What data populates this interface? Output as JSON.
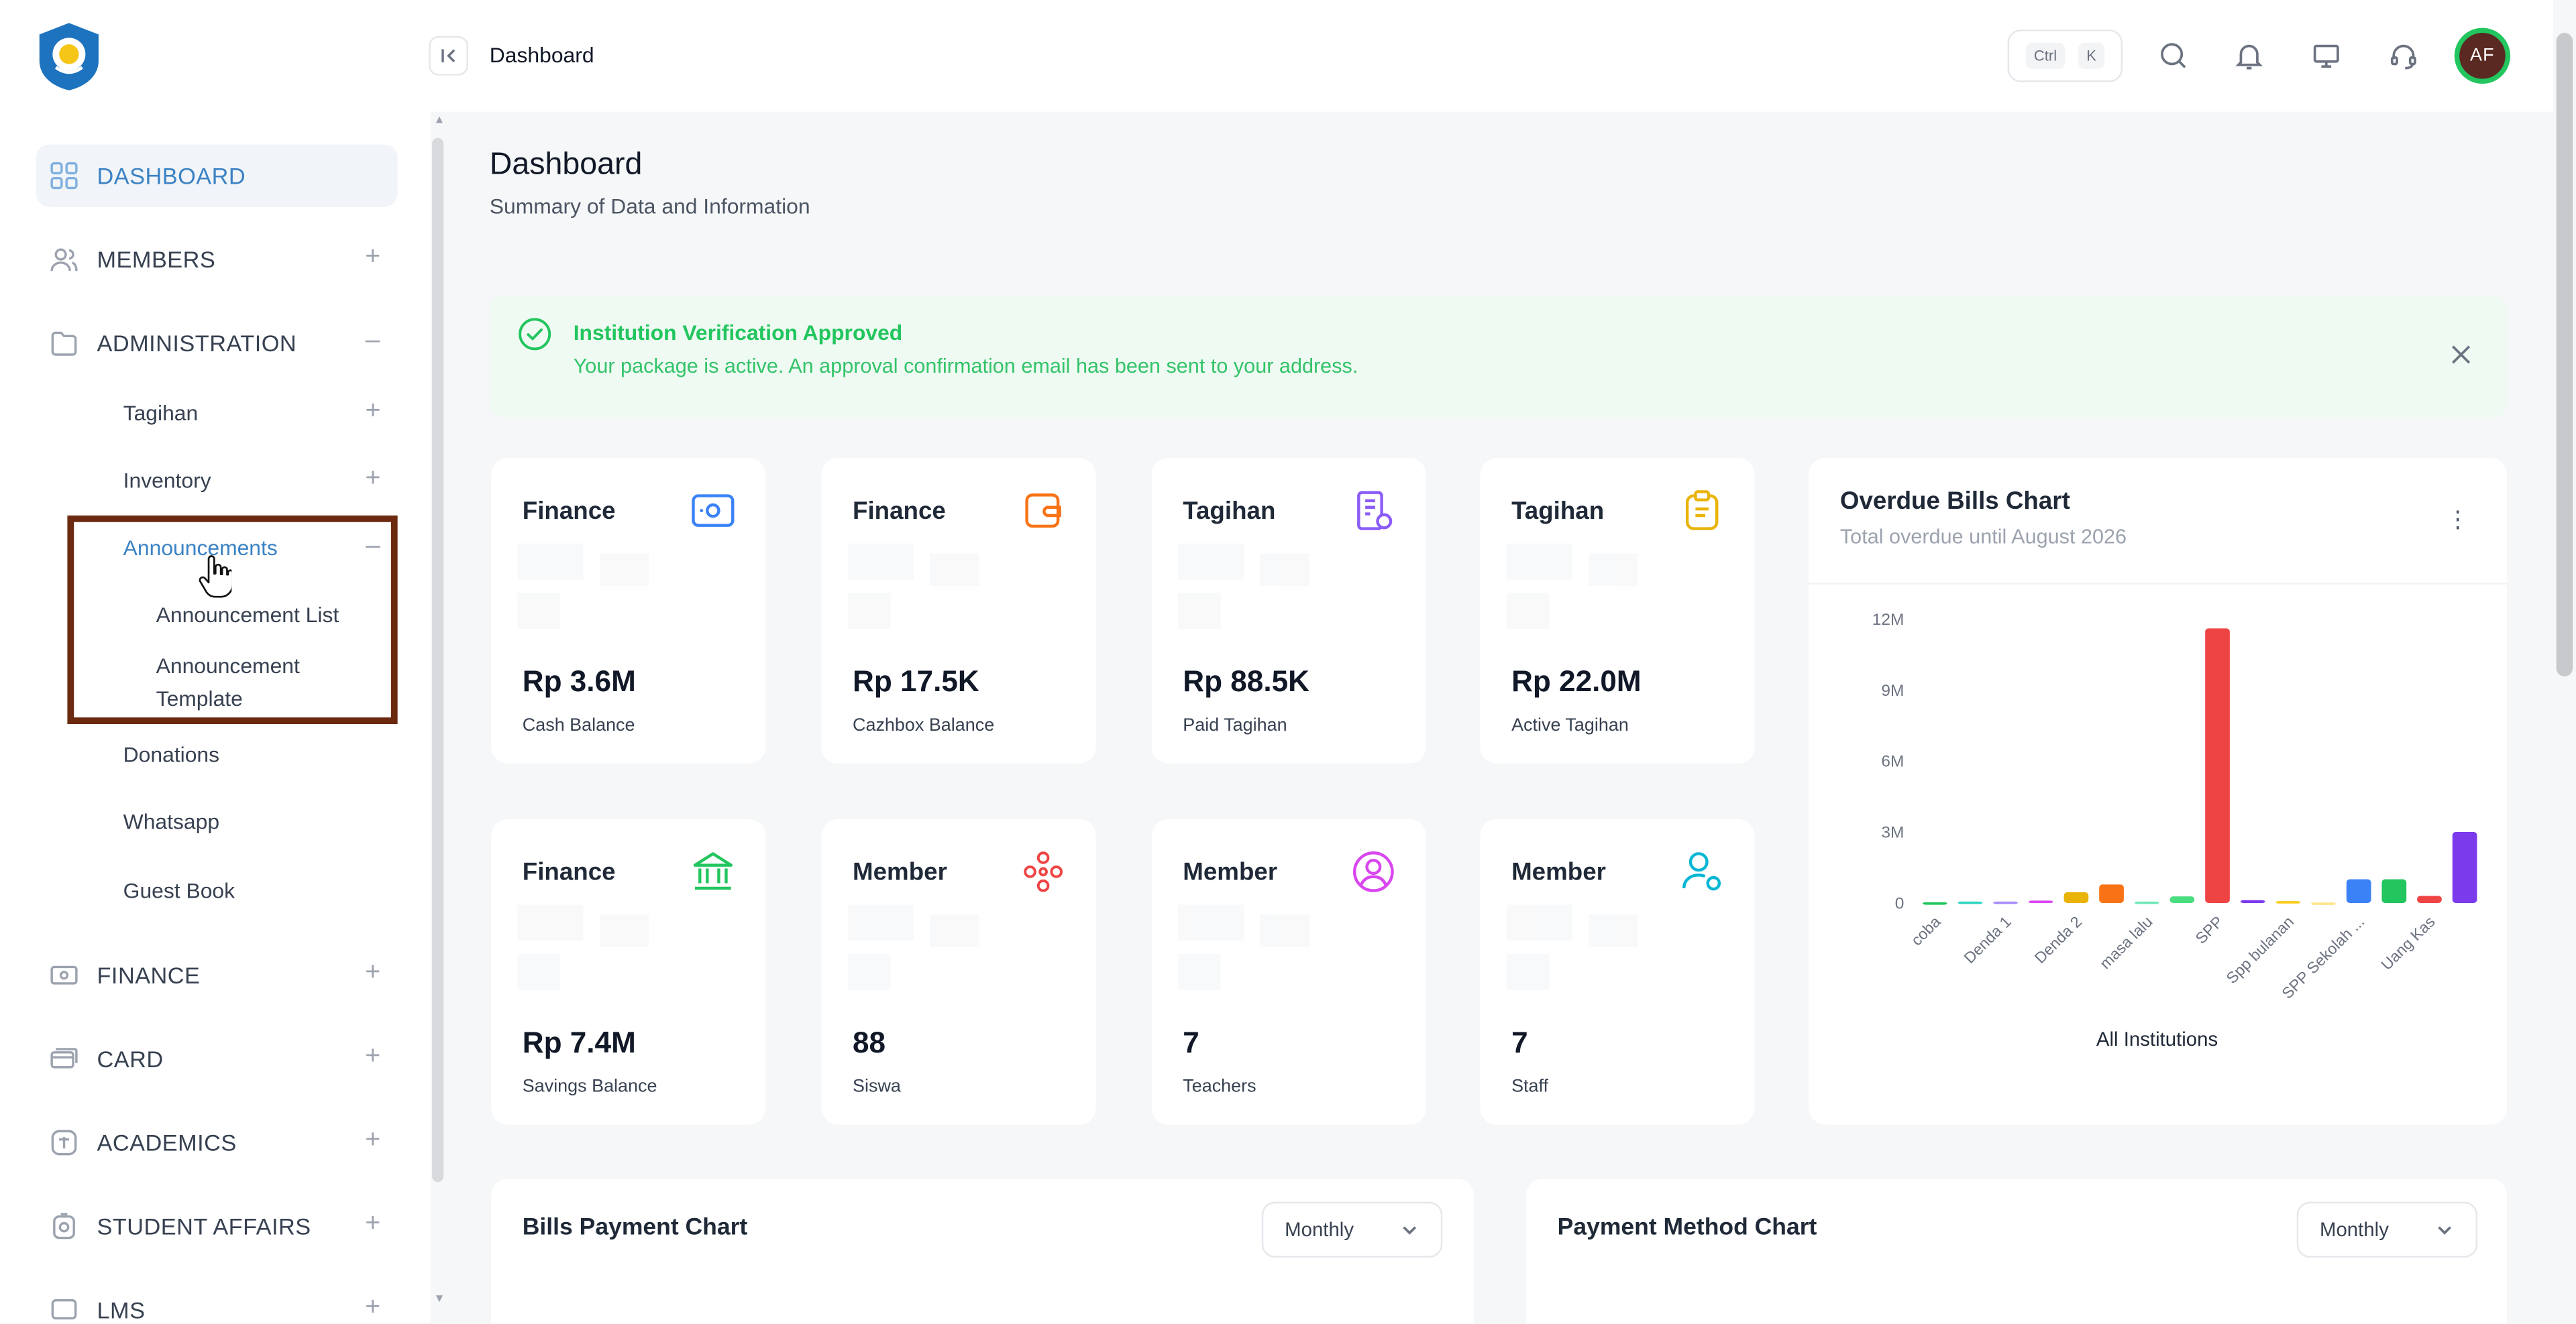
{
  "topbar": {
    "title": "Dashboard",
    "kbd_ctrl": "Ctrl",
    "kbd_k": "K",
    "avatar_initials": "AF",
    "icons": [
      "search-icon",
      "bell-icon",
      "monitor-icon",
      "headset-icon"
    ]
  },
  "sidebar": {
    "items": [
      {
        "label": "DASHBOARD",
        "icon": "grid-icon",
        "active": true
      },
      {
        "label": "MEMBERS",
        "icon": "users-icon",
        "toggle": "+"
      },
      {
        "label": "ADMINISTRATION",
        "icon": "folder-icon",
        "toggle": "–"
      },
      {
        "label": "FINANCE",
        "icon": "cash-icon",
        "toggle": "+"
      },
      {
        "label": "CARD",
        "icon": "card-icon",
        "toggle": "+"
      },
      {
        "label": "ACADEMICS",
        "icon": "book-icon",
        "toggle": "+"
      },
      {
        "label": "STUDENT AFFAIRS",
        "icon": "badge-icon",
        "toggle": "+"
      },
      {
        "label": "LMS",
        "icon": "lms-icon",
        "toggle": "+"
      }
    ],
    "admin_sub": [
      {
        "label": "Tagihan",
        "toggle": "+"
      },
      {
        "label": "Inventory",
        "toggle": "+"
      },
      {
        "label": "Announcements",
        "toggle": "–"
      },
      {
        "label": "Donations"
      },
      {
        "label": "Whatsapp"
      },
      {
        "label": "Guest Book"
      }
    ],
    "announcement_sub": [
      {
        "label": "Announcement List"
      },
      {
        "label": "Announcement Template"
      }
    ]
  },
  "page": {
    "title": "Dashboard",
    "subtitle": "Summary of Data and Information"
  },
  "alert": {
    "title": "Institution Verification Approved",
    "message": "Your package is active. An approval confirmation email has been sent to your address."
  },
  "cards": [
    {
      "label": "Finance",
      "value": "Rp 3.6M",
      "sub": "Cash Balance",
      "icon": "cash-register-icon",
      "color": "#3b82f6"
    },
    {
      "label": "Finance",
      "value": "Rp 17.5K",
      "sub": "Cazhbox Balance",
      "icon": "wallet-icon",
      "color": "#f97316"
    },
    {
      "label": "Tagihan",
      "value": "Rp 88.5K",
      "sub": "Paid Tagihan",
      "icon": "invoice-icon",
      "color": "#8b5cf6"
    },
    {
      "label": "Tagihan",
      "value": "Rp 22.0M",
      "sub": "Active Tagihan",
      "icon": "clipboard-icon",
      "color": "#eab308"
    },
    {
      "label": "Finance",
      "value": "Rp 7.4M",
      "sub": "Savings Balance",
      "icon": "bank-icon",
      "color": "#22c55e"
    },
    {
      "label": "Member",
      "value": "88",
      "sub": "Siswa",
      "icon": "group-icon",
      "color": "#ef4444"
    },
    {
      "label": "Member",
      "value": "7",
      "sub": "Teachers",
      "icon": "user-circle-icon",
      "color": "#d946ef"
    },
    {
      "label": "Member",
      "value": "7",
      "sub": "Staff",
      "icon": "user-settings-icon",
      "color": "#06b6d4"
    }
  ],
  "overdue": {
    "title": "Overdue Bills Chart",
    "subtitle": "Total overdue until August 2026",
    "menu_icon": "more-vertical-icon"
  },
  "chart_data": {
    "type": "bar",
    "title": "",
    "xlabel": "All Institutions",
    "ylabel": "",
    "ylim": [
      0,
      12000000
    ],
    "yticks": [
      "0",
      "3M",
      "6M",
      "9M",
      "12M"
    ],
    "categories": [
      "coba",
      "",
      "Denda 1",
      "",
      "Denda 2",
      "",
      "masa lalu",
      "",
      "SPP",
      "",
      "Spp bulanan",
      "",
      "SPP Sekolah ...",
      "",
      "Uang Kas",
      ""
    ],
    "values": [
      30000,
      60000,
      60000,
      100000,
      450000,
      780000,
      60000,
      280000,
      11600000,
      120000,
      80000,
      20000,
      1000000,
      1000000,
      300000,
      3000000
    ],
    "colors": [
      "#22c55e",
      "#2dd4bf",
      "#a78bfa",
      "#d946ef",
      "#eab308",
      "#f97316",
      "#6ee7b7",
      "#4ade80",
      "#ef4444",
      "#7c3aed",
      "#facc15",
      "#fde68a",
      "#3b82f6",
      "#22c55e",
      "#ef4444",
      "#7c3aed"
    ],
    "legend": "none",
    "grid": false
  },
  "bottom": {
    "bills_title": "Bills Payment Chart",
    "bills_select": "Monthly",
    "method_title": "Payment Method Chart",
    "method_select": "Monthly"
  }
}
